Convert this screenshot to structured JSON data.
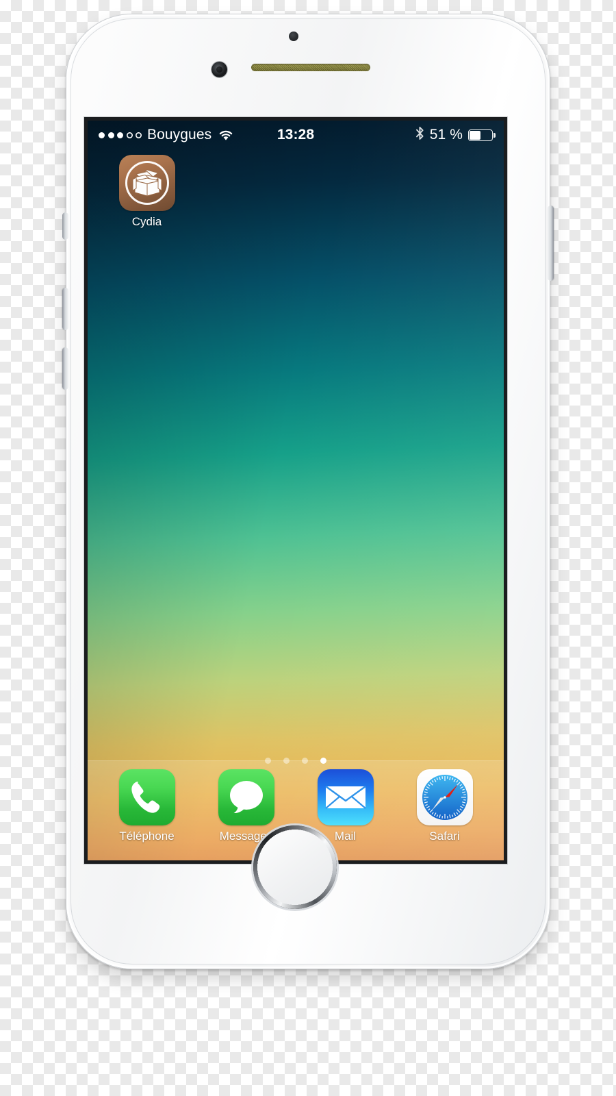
{
  "device": {
    "name": "iPhone 6 Silver",
    "hardware": {
      "front_camera": "front-camera",
      "proximity_sensor": "proximity-sensor",
      "earpiece_speaker": "earpiece-speaker",
      "home_button": "home-button",
      "power_button": "power-button",
      "volume_up": "volume-up-button",
      "volume_down": "volume-down-button",
      "ring_silent_switch": "ring-silent-switch"
    }
  },
  "status_bar": {
    "signal_dots_filled": 3,
    "signal_dots_total": 5,
    "carrier": "Bouygues",
    "wifi_icon": "wifi-icon",
    "time": "13:28",
    "bluetooth_icon": "bluetooth-icon",
    "battery_percent_label": "51 %",
    "battery_level": 51
  },
  "home_screen": {
    "apps": [
      {
        "label": "Cydia",
        "icon": "cydia-icon"
      }
    ],
    "page_dots": {
      "count": 4,
      "active_index": 3
    }
  },
  "dock": {
    "items": [
      {
        "label": "Téléphone",
        "icon": "phone-icon"
      },
      {
        "label": "Messages",
        "icon": "messages-icon"
      },
      {
        "label": "Mail",
        "icon": "mail-icon"
      },
      {
        "label": "Safari",
        "icon": "safari-icon"
      }
    ]
  },
  "colors": {
    "wallpaper_top": "#031a2c",
    "wallpaper_teal": "#07797e",
    "wallpaper_green": "#86d18b",
    "wallpaper_yellow": "#eab451",
    "wallpaper_bottom": "#e08f4c",
    "phone_green": "#49d853",
    "mail_blue": "#1f7ef0",
    "safari_blue": "#1f8fe0",
    "safari_red": "#f0352b",
    "cydia_brown": "#a9724c",
    "device_body": "#f4f5f6"
  }
}
